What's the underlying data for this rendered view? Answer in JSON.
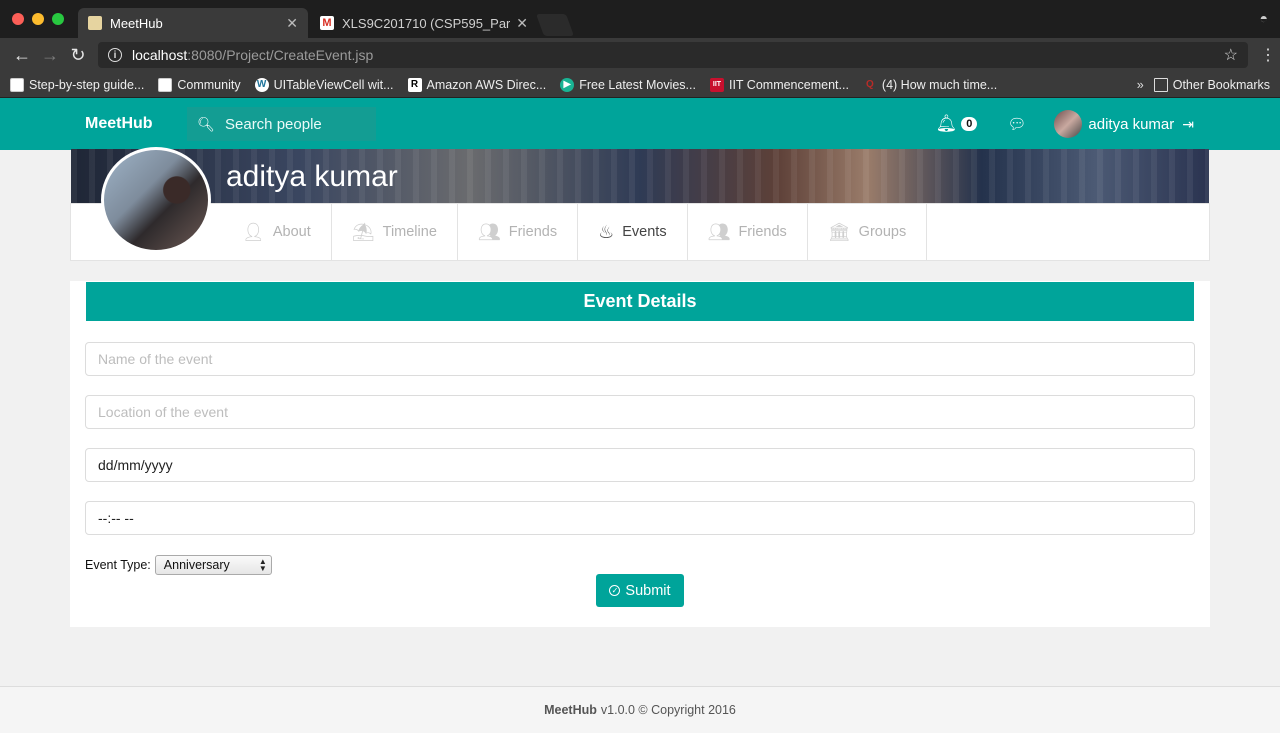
{
  "browser": {
    "tabs": [
      {
        "title": "MeetHub",
        "active": true
      },
      {
        "title": "XLS9C201710 (CSP595_Pare",
        "active": false
      }
    ],
    "url_host": "localhost",
    "url_rest": ":8080/Project/CreateEvent.jsp",
    "bookmarks": [
      {
        "label": "Step-by-step guide...",
        "icon": "page-icon"
      },
      {
        "label": "Community",
        "icon": "page-icon"
      },
      {
        "label": "UITableViewCell wit...",
        "icon": "wordpress-icon"
      },
      {
        "label": "Amazon AWS Direc...",
        "icon": "r-icon"
      },
      {
        "label": "Free Latest Movies...",
        "icon": "play-icon"
      },
      {
        "label": "IIT Commencement...",
        "icon": "iit-icon"
      },
      {
        "label": "(4) How much time...",
        "icon": "quora-icon"
      }
    ],
    "other_bookmarks": "Other Bookmarks"
  },
  "navbar": {
    "brand": "MeetHub",
    "search_placeholder": "Search people",
    "notification_count": "0",
    "user_name": "aditya kumar"
  },
  "profile": {
    "name": "aditya kumar",
    "tabs": [
      {
        "label": "About",
        "icon": "user-icon",
        "active": false
      },
      {
        "label": "Timeline",
        "icon": "timeline-icon",
        "active": false
      },
      {
        "label": "Friends",
        "icon": "friends-icon",
        "active": false
      },
      {
        "label": "Events",
        "icon": "cake-icon",
        "active": true
      },
      {
        "label": "Friends",
        "icon": "friends-icon",
        "active": false
      },
      {
        "label": "Groups",
        "icon": "bank-icon",
        "active": false
      }
    ]
  },
  "form": {
    "title": "Event Details",
    "name_placeholder": "Name of the event",
    "location_placeholder": "Location of the event",
    "date_value": "dd/mm/yyyy",
    "time_value": "--:-- --",
    "event_type_label": "Event Type:",
    "event_type_selected": "Anniversary",
    "submit_label": "Submit"
  },
  "footer": {
    "brand": "MeetHub",
    "text": "v1.0.0 © Copyright 2016"
  },
  "colors": {
    "accent": "#00a49a",
    "chrome_dark": "#3a3a3a"
  }
}
